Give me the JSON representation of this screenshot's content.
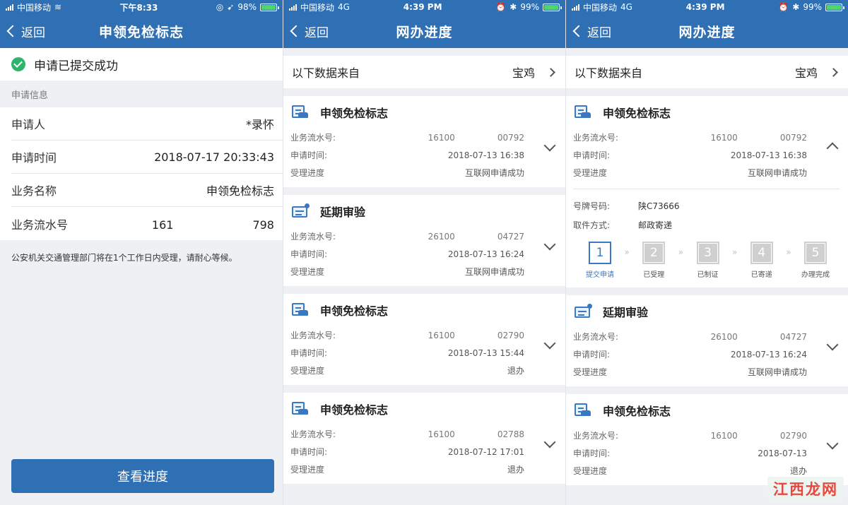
{
  "screens": [
    {
      "status": {
        "carrier": "中国移动",
        "network": "",
        "time": "下午8:33",
        "battery": "98%",
        "battery_level": 0.98
      },
      "nav": {
        "back_label": "返回",
        "title": "申领免检标志"
      },
      "success_text": "申请已提交成功",
      "section_title": "申请信息",
      "info_rows": [
        {
          "label": "申请人",
          "value": "*录怀"
        },
        {
          "label": "申请时间",
          "value": "2018-07-17 20:33:43"
        },
        {
          "label": "业务名称",
          "value": "申领免检标志"
        },
        {
          "label": "业务流水号",
          "value": "161　　　　　　　798"
        }
      ],
      "notice": "公安机关交通管理部门将在1个工作日内受理，请耐心等候。",
      "primary_button": "查看进度"
    },
    {
      "status": {
        "carrier": "中国移动",
        "network": "4G",
        "time": "4:39 PM",
        "battery": "99%",
        "battery_level": 0.99
      },
      "nav": {
        "back_label": "返回",
        "title": "网办进度"
      },
      "source": {
        "label": "以下数据来自",
        "city": "宝鸡"
      },
      "cards": [
        {
          "icon": "license-doc-icon",
          "title": "申领免检标志",
          "fields": [
            {
              "k": "业务流水号:",
              "v": "16100　　　　　00792"
            },
            {
              "k": "申请时间:",
              "v": "2018-07-13 16:38"
            },
            {
              "k": "受理进度",
              "v": "互联网申请成功"
            }
          ]
        },
        {
          "icon": "id-card-icon",
          "title": "延期审验",
          "fields": [
            {
              "k": "业务流水号:",
              "v": "26100　　　　　04727"
            },
            {
              "k": "申请时间:",
              "v": "2018-07-13 16:24"
            },
            {
              "k": "受理进度",
              "v": "互联网申请成功"
            }
          ]
        },
        {
          "icon": "license-doc-icon",
          "title": "申领免检标志",
          "fields": [
            {
              "k": "业务流水号:",
              "v": "16100　　　　　02790"
            },
            {
              "k": "申请时间:",
              "v": "2018-07-13 15:44"
            },
            {
              "k": "受理进度",
              "v": "退办"
            }
          ]
        },
        {
          "icon": "license-doc-icon",
          "title": "申领免检标志",
          "fields": [
            {
              "k": "业务流水号:",
              "v": "16100　　　　　02788"
            },
            {
              "k": "申请时间:",
              "v": "2018-07-12 17:01"
            },
            {
              "k": "受理进度",
              "v": "退办"
            }
          ]
        }
      ]
    },
    {
      "status": {
        "carrier": "中国移动",
        "network": "4G",
        "time": "4:39 PM",
        "battery": "99%",
        "battery_level": 0.99
      },
      "nav": {
        "back_label": "返回",
        "title": "网办进度"
      },
      "source": {
        "label": "以下数据来自",
        "city": "宝鸡"
      },
      "expanded_card": {
        "title": "申领免检标志",
        "fields": [
          {
            "k": "业务流水号:",
            "v": "16100　　　　　00792"
          },
          {
            "k": "申请时间:",
            "v": "2018-07-13 16:38"
          },
          {
            "k": "受理进度",
            "v": "互联网申请成功"
          }
        ],
        "details": [
          {
            "k": "号牌号码:",
            "v": "陕C73666"
          },
          {
            "k": "取件方式:",
            "v": "邮政寄递"
          }
        ],
        "steps": [
          {
            "num": "1",
            "label": "提交申请"
          },
          {
            "num": "2",
            "label": "已受理"
          },
          {
            "num": "3",
            "label": "已制证"
          },
          {
            "num": "4",
            "label": "已寄递"
          },
          {
            "num": "5",
            "label": "办理完成"
          }
        ],
        "step_separator": "»"
      },
      "cards": [
        {
          "icon": "id-card-icon",
          "title": "延期审验",
          "fields": [
            {
              "k": "业务流水号:",
              "v": "26100　　　　　04727"
            },
            {
              "k": "申请时间:",
              "v": "2018-07-13 16:24"
            },
            {
              "k": "受理进度",
              "v": "互联网申请成功"
            }
          ]
        },
        {
          "icon": "license-doc-icon",
          "title": "申领免检标志",
          "fields": [
            {
              "k": "业务流水号:",
              "v": "16100　　　　　02790"
            },
            {
              "k": "申请时间:",
              "v": "2018-07-13"
            },
            {
              "k": "受理进度",
              "v": "退办"
            }
          ]
        }
      ],
      "watermark": "江西龙网"
    }
  ],
  "colors": {
    "brand": "#2f6fb3",
    "success": "#2db56c",
    "battery": "#4cd964",
    "watermark": "#e8483e"
  }
}
